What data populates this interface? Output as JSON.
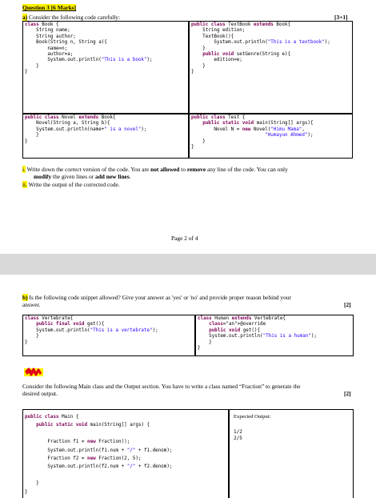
{
  "page1": {
    "question_title": "Question 3 [6 Marks]",
    "part_a_label": "a)",
    "part_a_text": " Consider the following code carefully:",
    "part_a_marks": "[3+1]",
    "boxes": {
      "book": "class Book {\n    String name;\n    String author;\n    Book(String n, String a){\n        name=n;\n        author=a;\n        System.out.println(\"This is a book\");\n    }\n}",
      "textbook": "public class TextBook extends Book{\n    String edition;\n    TextBook(){\n        System.out.println(\"This is a textbook\");\n    }\n    public void setGenre(String e){\n        edition=e;\n    }\n}",
      "novel": "public class Novel extends Book{\n    Novel(String a, String b){\n    System.out.println(name+\" is a novel\");\n    }\n}",
      "test": "public class Test {\n    public static void main(String[] args){\n        Novel N = new Novel(\"Himu Mama\",\n                          \"Humayun Ahmed\");\n    }\n}"
    },
    "instructions": [
      {
        "num": "i.",
        "text_pre": " Write down the correct version of the code. You are ",
        "bold1": "not allowed",
        "text_mid": " to ",
        "bold2": "remove",
        "text_post": " any line of the code. You can only",
        "line2_bold_a": "modify",
        "line2_mid": " the given lines or ",
        "line2_bold_b": "add new lines",
        "line2_end": "."
      },
      {
        "num": "ii.",
        "text": " Write the output of the corrected code."
      }
    ],
    "footer": "Page 2 of 4"
  },
  "page2": {
    "part_b_label": "b)",
    "part_b_text": " Is the following code snippet allowed? Give your answer as 'yes' or 'no' and provide proper reason behind your",
    "part_b_text2": "answer.",
    "part_b_marks": "[2]",
    "boxes": {
      "vertebrate": "class Vertebrate{\n    public final void get(){\n    System.out.println(\"This is a vertebrate\");\n    }\n}",
      "human": "class Human extends Vertebrate{\n    @override\n    public void get(){\n    System.out.println(\"This is a human\");\n    }\n}"
    },
    "fraction_text": "Consider the following Main class and the Output section. You have to write a class named “Fraction” to generate the",
    "fraction_text2": "desired output.",
    "fraction_marks": "[2]",
    "main_code": "public class Main {\n    public static void main(String[] args) {\n\n        Fraction f1 = new Fraction();\n        System.out.println(f1.num + \"/\" + f1.denom);\n        Fraction f2 = new Fraction(2, 5);\n        System.out.println(f2.num + \"/\" + f2.denom);\n\n    }\n}",
    "expected_title": "Expected Output:",
    "expected_lines": [
      "1/2",
      "2/5"
    ]
  },
  "colors": {
    "highlight": "#fff200",
    "keyword": "#7f0055",
    "string": "#2a00ff",
    "scribble": "#e0001a"
  }
}
